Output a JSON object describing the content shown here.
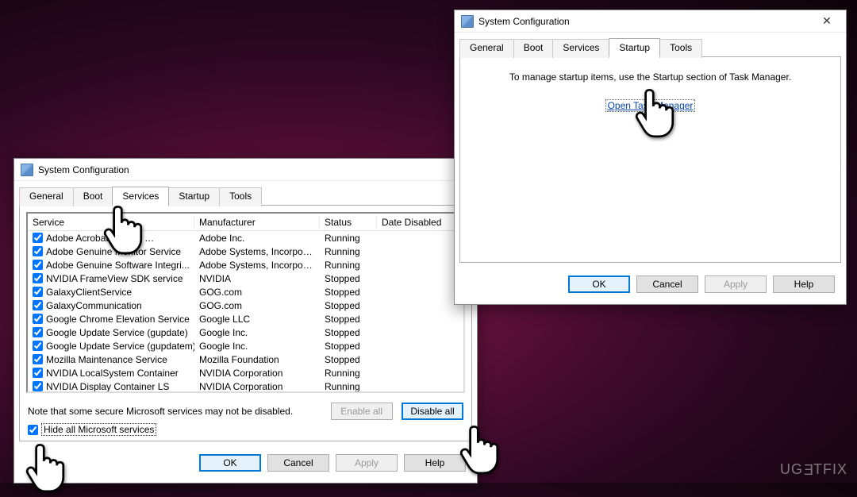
{
  "watermark": "UG€TFIX",
  "win1": {
    "title": "System Configuration",
    "tabs": [
      "General",
      "Boot",
      "Services",
      "Startup",
      "Tools"
    ],
    "active_tab": "Services",
    "columns": [
      "Service",
      "Manufacturer",
      "Status",
      "Date Disabled"
    ],
    "services": [
      {
        "name": "Adobe Acrobat Update …",
        "manufacturer": "Adobe Inc.",
        "status": "Running",
        "disabled": ""
      },
      {
        "name": "Adobe Genuine Monitor Service",
        "manufacturer": "Adobe Systems, Incorpora...",
        "status": "Running",
        "disabled": ""
      },
      {
        "name": "Adobe Genuine Software Integri...",
        "manufacturer": "Adobe Systems, Incorpora...",
        "status": "Running",
        "disabled": ""
      },
      {
        "name": "NVIDIA FrameView SDK service",
        "manufacturer": "NVIDIA",
        "status": "Stopped",
        "disabled": ""
      },
      {
        "name": "GalaxyClientService",
        "manufacturer": "GOG.com",
        "status": "Stopped",
        "disabled": ""
      },
      {
        "name": "GalaxyCommunication",
        "manufacturer": "GOG.com",
        "status": "Stopped",
        "disabled": ""
      },
      {
        "name": "Google Chrome Elevation Service",
        "manufacturer": "Google LLC",
        "status": "Stopped",
        "disabled": ""
      },
      {
        "name": "Google Update Service (gupdate)",
        "manufacturer": "Google Inc.",
        "status": "Stopped",
        "disabled": ""
      },
      {
        "name": "Google Update Service (gupdatem)",
        "manufacturer": "Google Inc.",
        "status": "Stopped",
        "disabled": ""
      },
      {
        "name": "Mozilla Maintenance Service",
        "manufacturer": "Mozilla Foundation",
        "status": "Stopped",
        "disabled": ""
      },
      {
        "name": "NVIDIA LocalSystem Container",
        "manufacturer": "NVIDIA Corporation",
        "status": "Running",
        "disabled": ""
      },
      {
        "name": "NVIDIA Display Container LS",
        "manufacturer": "NVIDIA Corporation",
        "status": "Running",
        "disabled": ""
      }
    ],
    "note": "Note that some secure Microsoft services may not be disabled.",
    "enable_all": "Enable all",
    "disable_all": "Disable all",
    "hide_label": "Hide all Microsoft services",
    "buttons": {
      "ok": "OK",
      "cancel": "Cancel",
      "apply": "Apply",
      "help": "Help"
    }
  },
  "win2": {
    "title": "System Configuration",
    "tabs": [
      "General",
      "Boot",
      "Services",
      "Startup",
      "Tools"
    ],
    "active_tab": "Startup",
    "msg": "To manage startup items, use the Startup section of Task Manager.",
    "link": "Open Task Manager",
    "buttons": {
      "ok": "OK",
      "cancel": "Cancel",
      "apply": "Apply",
      "help": "Help"
    }
  }
}
